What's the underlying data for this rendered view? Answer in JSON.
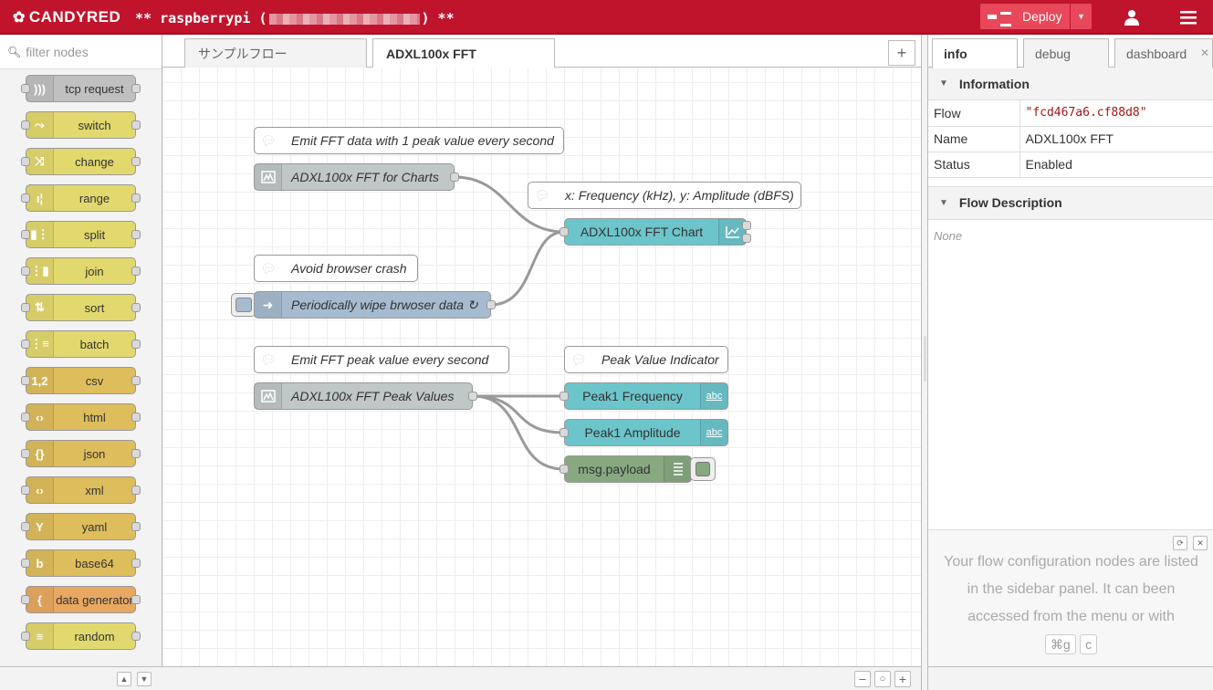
{
  "header": {
    "logo": "CANDYRED",
    "hostname_prefix": "** raspberrypi (",
    "hostname_suffix": ") **",
    "deploy_label": "Deploy"
  },
  "palette": {
    "filter_placeholder": "filter nodes",
    "nodes": [
      {
        "label": "tcp request",
        "color": "#c0c0c0",
        "icon": "signal-icon"
      },
      {
        "label": "switch",
        "color": "#e2d96e",
        "icon": "switch-icon"
      },
      {
        "label": "change",
        "color": "#e2d96e",
        "icon": "shuffle-icon"
      },
      {
        "label": "range",
        "color": "#e2d96e",
        "icon": "range-icon"
      },
      {
        "label": "split",
        "color": "#e2d96e",
        "icon": "split-icon"
      },
      {
        "label": "join",
        "color": "#e2d96e",
        "icon": "join-icon"
      },
      {
        "label": "sort",
        "color": "#e2d96e",
        "icon": "sort-icon"
      },
      {
        "label": "batch",
        "color": "#e2d96e",
        "icon": "batch-icon"
      },
      {
        "label": "csv",
        "color": "#debd5c",
        "icon": "csv-icon"
      },
      {
        "label": "html",
        "color": "#debd5c",
        "icon": "html-icon"
      },
      {
        "label": "json",
        "color": "#debd5c",
        "icon": "json-icon"
      },
      {
        "label": "xml",
        "color": "#debd5c",
        "icon": "xml-icon"
      },
      {
        "label": "yaml",
        "color": "#debd5c",
        "icon": "yaml-icon"
      },
      {
        "label": "base64",
        "color": "#debd5c",
        "icon": "base64-icon"
      },
      {
        "label": "data generator",
        "color": "#e8a861",
        "icon": "brace-icon"
      },
      {
        "label": "random",
        "color": "#e2d96e",
        "icon": "list-icon"
      }
    ]
  },
  "workspace": {
    "tabs": [
      {
        "label": "サンプルフロー",
        "active": false
      },
      {
        "label": "ADXL100x FFT",
        "active": true
      }
    ],
    "add_tab": "+",
    "nodes": {
      "comment1": "Emit FFT data with 1 peak value every second",
      "charts": "ADXL100x FFT for Charts",
      "comment2": "x: Frequency (kHz), y: Amplitude (dBFS)",
      "chart": "ADXL100x FFT Chart",
      "comment3": "Avoid browser crash",
      "wipe": "Periodically wipe brwoser data ↻",
      "comment4": "Emit FFT peak value every second",
      "comment5": "Peak Value Indicator",
      "peak": "ADXL100x FFT Peak Values",
      "freq": "Peak1 Frequency",
      "amp": "Peak1 Amplitude",
      "debug": "msg.payload"
    },
    "abc": "abc",
    "zoom_out": "−",
    "zoom_reset": "○",
    "zoom_in": "+"
  },
  "sidebar": {
    "tabs": [
      "info",
      "debug",
      "dashboard"
    ],
    "info_header": "Information",
    "rows": [
      {
        "key": "Flow",
        "value": "\"fcd467a6.cf88d8\""
      },
      {
        "key": "Name",
        "value": "ADXL100x FFT"
      },
      {
        "key": "Status",
        "value": "Enabled"
      }
    ],
    "desc_header": "Flow Description",
    "desc_value": "None",
    "tip_text": "Your flow configuration nodes are listed in the sidebar panel. It can been accessed from the menu or with",
    "tip_key1": "⌘g",
    "tip_key2": "c"
  },
  "colors": {
    "header": "#c0142d",
    "deploy": "#e8485a",
    "ui_teal": "#6cc5cb",
    "inject_blue": "#a6bbcf",
    "function_gray": "#c0c7c7",
    "debug_green": "#87a980"
  }
}
